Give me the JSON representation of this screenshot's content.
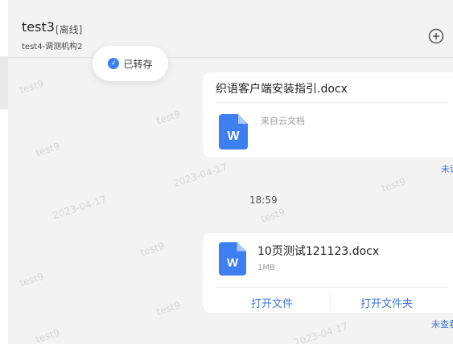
{
  "header": {
    "contact_name": "test3",
    "status": "[离线]",
    "org": "test4-调测机构2"
  },
  "toast": {
    "text": "已转存"
  },
  "messages": [
    {
      "title": "织语客户端安装指引.docx",
      "source": "来自云文档",
      "read_status": "未读"
    },
    {
      "time": "18:59",
      "file_name": "10页测试121123.docx",
      "file_size": "1MB",
      "open_file": "打开文件",
      "open_folder": "打开文件夹",
      "read_status": "未查看"
    }
  ],
  "watermark": {
    "user": "test9",
    "date": "2023-04-17"
  },
  "colors": {
    "accent": "#3f73d8",
    "word_icon": "#3d7ff0",
    "background": "#f3f3f3",
    "card": "#ffffff"
  },
  "icons": {
    "add": "add-circle-icon",
    "check": "check-circle-icon",
    "word": "word-file-icon"
  }
}
